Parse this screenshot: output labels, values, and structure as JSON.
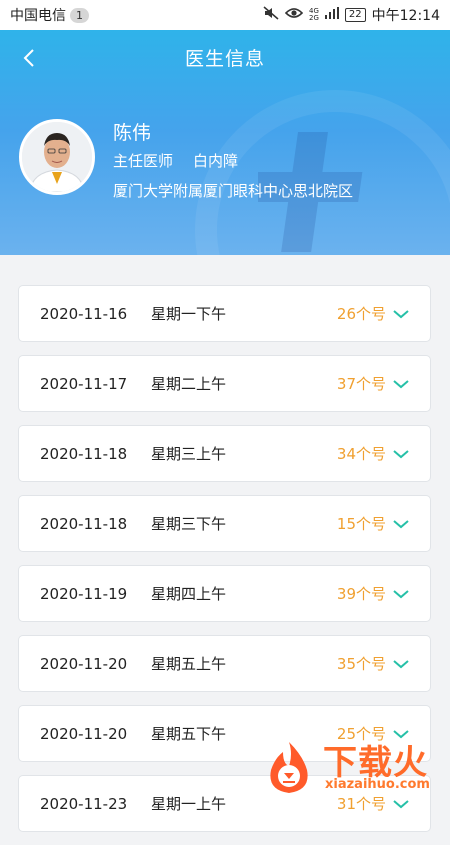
{
  "status_bar": {
    "carrier": "中国电信",
    "notification_count": "1",
    "network_top": "4G",
    "network_bottom": "2G",
    "battery": "22",
    "time": "中午12:14"
  },
  "nav": {
    "title": "医生信息",
    "back_icon": "chevron-left-icon"
  },
  "doctor": {
    "name": "陈伟",
    "title": "主任医师",
    "department": "白内障",
    "hospital": "厦门大学附属厦门眼科中心思北院区"
  },
  "schedule": [
    {
      "date": "2020-11-16",
      "slot": "星期一下午",
      "count": "26个号"
    },
    {
      "date": "2020-11-17",
      "slot": "星期二上午",
      "count": "37个号"
    },
    {
      "date": "2020-11-18",
      "slot": "星期三上午",
      "count": "34个号"
    },
    {
      "date": "2020-11-18",
      "slot": "星期三下午",
      "count": "15个号"
    },
    {
      "date": "2020-11-19",
      "slot": "星期四上午",
      "count": "39个号"
    },
    {
      "date": "2020-11-20",
      "slot": "星期五上午",
      "count": "35个号"
    },
    {
      "date": "2020-11-20",
      "slot": "星期五下午",
      "count": "25个号"
    },
    {
      "date": "2020-11-23",
      "slot": "星期一上午",
      "count": "31个号"
    }
  ],
  "watermark": {
    "text": "下载火",
    "sub": "xiazaihuo.com"
  },
  "colors": {
    "header_top": "#2fb3ea",
    "header_bottom": "#6bb2ee",
    "count_color": "#f0a030",
    "chevron_color": "#26c0a8"
  }
}
